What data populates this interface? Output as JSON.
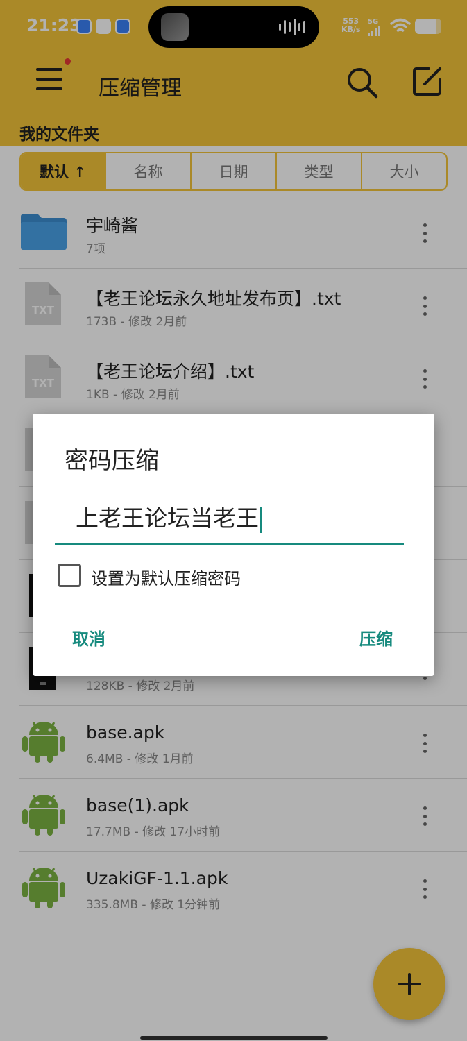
{
  "status_bar": {
    "time": "21:23",
    "net_speed_value": "553",
    "net_speed_unit": "KB/s",
    "network": "5G",
    "battery_level": 0.8
  },
  "app_bar": {
    "title": "压缩管理",
    "menu_icon": "hamburger-icon",
    "search_icon": "search-icon",
    "edit_icon": "edit-icon"
  },
  "folder_label": "我的文件夹",
  "sort_tabs": [
    {
      "label": "默认 ↑",
      "active": true
    },
    {
      "label": "名称",
      "active": false
    },
    {
      "label": "日期",
      "active": false
    },
    {
      "label": "类型",
      "active": false
    },
    {
      "label": "大小",
      "active": false
    }
  ],
  "files": [
    {
      "name": "宇崎酱",
      "meta": "7项",
      "icon": "folder"
    },
    {
      "name": "【老王论坛永久地址发布页】.txt",
      "meta": "173B - 修改 2月前",
      "icon": "txt"
    },
    {
      "name": "【老王论坛介绍】.txt",
      "meta": "1KB - 修改 2月前",
      "icon": "txt"
    },
    {
      "name": "",
      "meta": "",
      "icon": "txt"
    },
    {
      "name": "",
      "meta": "",
      "icon": "txt"
    },
    {
      "name": "",
      "meta": "",
      "icon": "image"
    },
    {
      "name": "",
      "meta": "128KB - 修改 2月前",
      "icon": "image"
    },
    {
      "name": "base.apk",
      "meta": "6.4MB - 修改 1月前",
      "icon": "apk"
    },
    {
      "name": "base(1).apk",
      "meta": "17.7MB - 修改 17小时前",
      "icon": "apk"
    },
    {
      "name": "UzakiGF-1.1.apk",
      "meta": "335.8MB - 修改 1分钟前",
      "icon": "apk"
    }
  ],
  "dialog": {
    "title": "密码压缩",
    "password_value": "上老王论坛当老王",
    "checkbox_label": "设置为默认压缩密码",
    "checkbox_checked": false,
    "cancel_label": "取消",
    "confirm_label": "压缩"
  },
  "colors": {
    "accent": "#f4c43a",
    "dialog_accent": "#168a7e",
    "folder": "#3d8fd1",
    "android": "#7cb342",
    "txt_icon": "#d5d5d5"
  },
  "fab_icon": "plus-icon"
}
